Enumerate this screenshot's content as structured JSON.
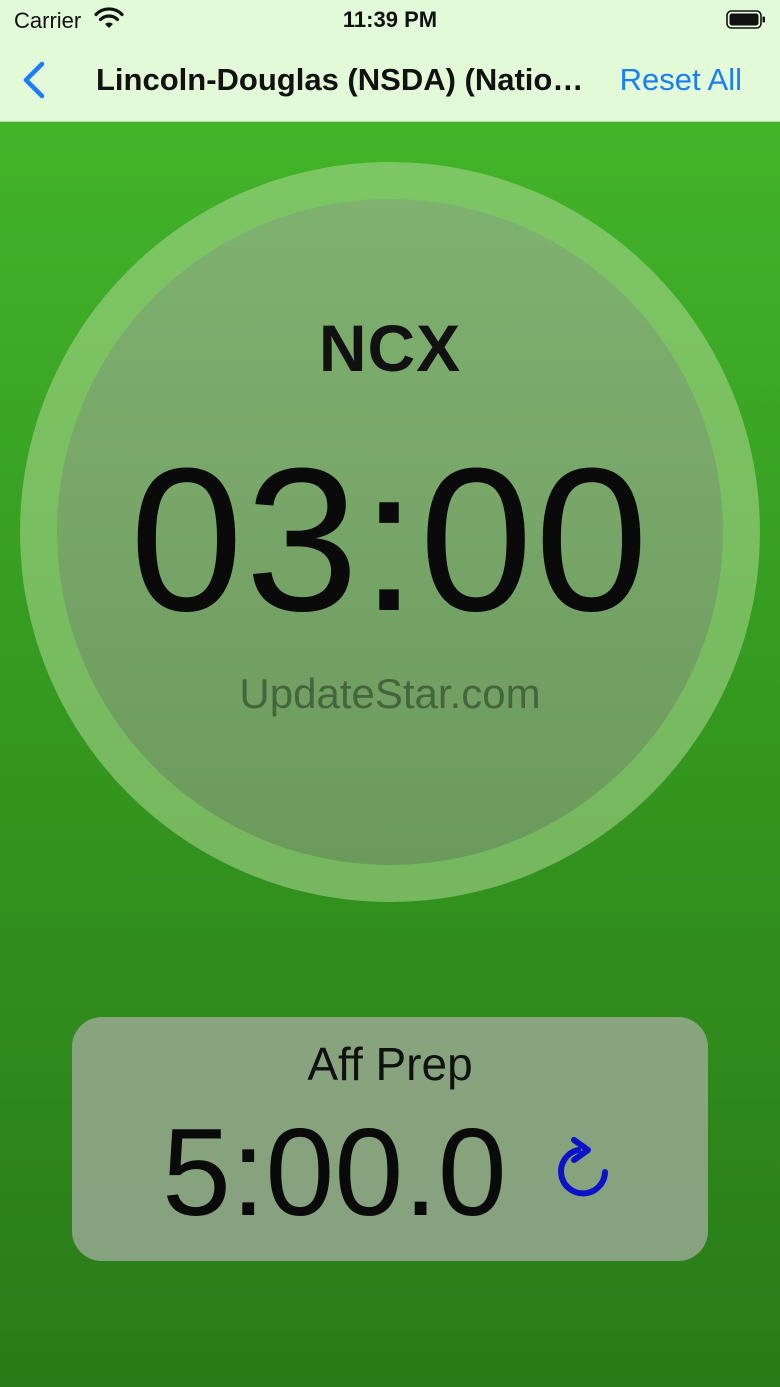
{
  "status_bar": {
    "carrier": "Carrier",
    "time": "11:39 PM"
  },
  "nav": {
    "back_icon": "chevron-left-icon",
    "title": "Lincoln-Douglas (NSDA) (Natio…",
    "reset_all_label": "Reset All"
  },
  "main_timer": {
    "speech_name": "NCX",
    "time": "03:00",
    "watermark": "UpdateStar.com"
  },
  "prep_timer": {
    "label": "Aff Prep",
    "time": "5:00.0",
    "reset_icon": "rotate-clockwise-icon"
  },
  "colors": {
    "accent": "#1a7ef7",
    "reset_icon": "#0b13c9",
    "background_green": "#3aa524",
    "nav_background": "#e2fad8"
  }
}
